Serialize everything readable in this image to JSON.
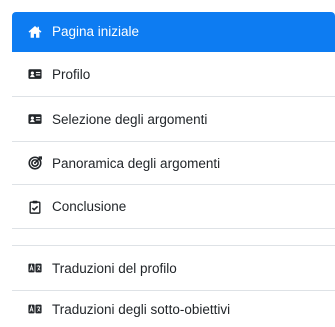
{
  "nav": {
    "items": [
      {
        "label": "Pagina iniziale",
        "icon": "home-icon",
        "active": true
      },
      {
        "label": "Profilo",
        "icon": "id-card-icon"
      },
      {
        "label": "Selezione degli argomenti",
        "icon": "id-card-icon"
      },
      {
        "label": "Panoramica degli argomenti",
        "icon": "target-icon"
      },
      {
        "label": "Conclusione",
        "icon": "clipboard-check-icon"
      }
    ],
    "secondary_items": [
      {
        "label": "Traduzioni del profilo",
        "icon": "language-icon"
      },
      {
        "label": "Traduzioni degli sotto-obiettivi",
        "icon": "language-icon"
      }
    ]
  },
  "colors": {
    "accent": "#0d7cf2",
    "divider": "#dee2e6"
  }
}
